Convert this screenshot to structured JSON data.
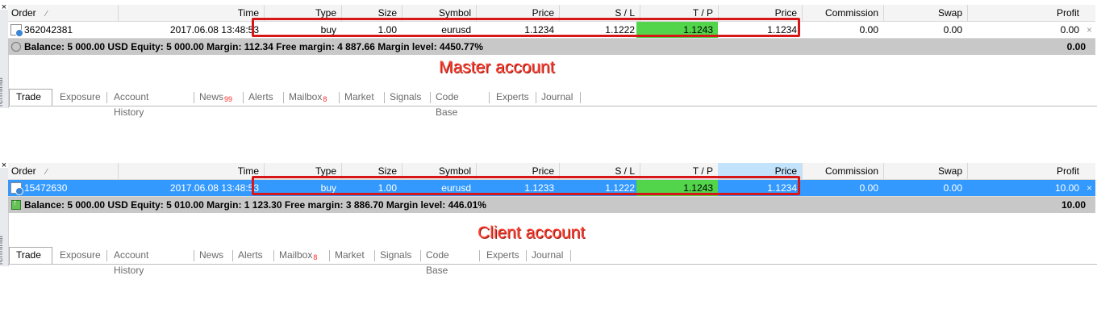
{
  "panels": {
    "master": {
      "header": {
        "order": "Order",
        "time": "Time",
        "type": "Type",
        "size": "Size",
        "symbol": "Symbol",
        "price": "Price",
        "sl": "S / L",
        "tp": "T / P",
        "price2": "Price",
        "commission": "Commission",
        "swap": "Swap",
        "profit": "Profit"
      },
      "order": {
        "id": "362042381",
        "time": "2017.06.08 13:48:53",
        "type": "buy",
        "size": "1.00",
        "symbol": "eurusd",
        "price": "1.1234",
        "sl": "1.1222",
        "tp": "1.1243",
        "price2": "1.1234",
        "commission": "0.00",
        "swap": "0.00",
        "profit": "0.00"
      },
      "summary": {
        "text": "Balance: 5 000.00 USD  Equity: 5 000.00  Margin: 112.34  Free margin: 4 887.66  Margin level: 4450.77%",
        "total": "0.00"
      },
      "label": "Master account",
      "tabs": [
        {
          "label": "Trade",
          "active": true
        },
        {
          "label": "Exposure"
        },
        {
          "label": "Account History"
        },
        {
          "label": "News",
          "badge": "99"
        },
        {
          "label": "Alerts"
        },
        {
          "label": "Mailbox",
          "badge": "8"
        },
        {
          "label": "Market"
        },
        {
          "label": "Signals"
        },
        {
          "label": "Code Base"
        },
        {
          "label": "Experts"
        },
        {
          "label": "Journal"
        }
      ]
    },
    "client": {
      "header": {
        "order": "Order",
        "time": "Time",
        "type": "Type",
        "size": "Size",
        "symbol": "Symbol",
        "price": "Price",
        "sl": "S / L",
        "tp": "T / P",
        "price2": "Price",
        "commission": "Commission",
        "swap": "Swap",
        "profit": "Profit"
      },
      "order": {
        "id": "15472630",
        "time": "2017.06.08 13:48:53",
        "type": "buy",
        "size": "1.00",
        "symbol": "eurusd",
        "price": "1.1233",
        "sl": "1.1222",
        "tp": "1.1243",
        "price2": "1.1234",
        "commission": "0.00",
        "swap": "0.00",
        "profit": "10.00"
      },
      "summary": {
        "text": "Balance: 5 000.00 USD  Equity: 5 010.00  Margin: 1 123.30  Free margin: 3 886.70  Margin level: 446.01%",
        "total": "10.00"
      },
      "label": "Client account",
      "tabs": [
        {
          "label": "Trade",
          "active": true
        },
        {
          "label": "Exposure"
        },
        {
          "label": "Account History"
        },
        {
          "label": "News"
        },
        {
          "label": "Alerts"
        },
        {
          "label": "Mailbox",
          "badge": "8"
        },
        {
          "label": "Market"
        },
        {
          "label": "Signals"
        },
        {
          "label": "Code Base"
        },
        {
          "label": "Experts"
        },
        {
          "label": "Journal"
        }
      ]
    }
  },
  "side_title": "Terminal",
  "colors": {
    "selection": "#3399ff",
    "tp_highlight": "#52d44b",
    "summary_bg": "#c8c8c8",
    "annotation_red": "#d71717",
    "label_red": "#ff3d2f",
    "badge_red": "#ff2a2a",
    "price_highlight": "#c2e3fb"
  },
  "icons": {
    "row": "order-document-icon",
    "summary_master": "circle-status-icon",
    "summary_client": "green-up-arrow-icon",
    "close_cell": "close-icon",
    "sort": "sort-icon"
  }
}
